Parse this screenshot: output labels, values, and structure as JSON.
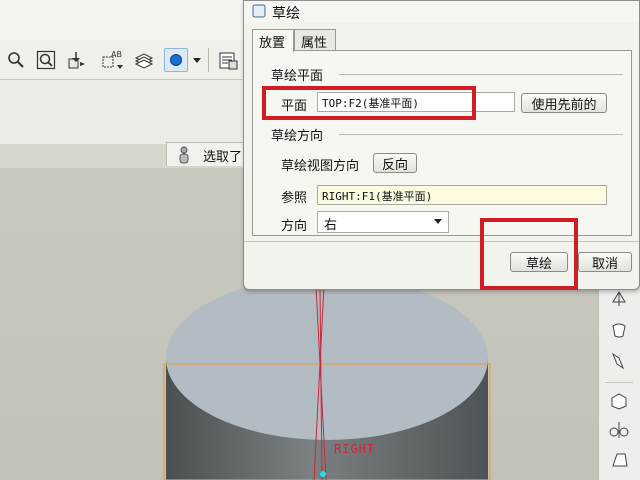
{
  "dialog": {
    "title": "草绘",
    "tabs": [
      {
        "label": "放置",
        "selected": true
      },
      {
        "label": "属性",
        "selected": false
      }
    ],
    "sketch_plane": {
      "group_title": "草绘平面",
      "plane_label": "平面",
      "plane_value": "TOP:F2(基准平面)",
      "use_previous_label": "使用先前的"
    },
    "sketch_orientation": {
      "group_title": "草绘方向",
      "view_direction_label": "草绘视图方向",
      "flip_label": "反向",
      "reference_label": "参照",
      "reference_value": "RIGHT:F1(基准平面)",
      "orientation_label": "方向",
      "orientation_value": "右"
    },
    "sketch_button_label": "草绘",
    "cancel_button_label": "取消"
  },
  "status": {
    "text": "选取了"
  },
  "viewport": {
    "datum_label": "RIGHT"
  },
  "colors": {
    "highlight": "#d01c24",
    "dialog_bg": "#f3f3ee",
    "model_gray": "#5e6365",
    "datum_red": "#c8283c"
  },
  "icons": [
    "zoom-icon",
    "zoom-window-icon",
    "repaint-icon",
    "plane-display-icon",
    "layers-icon",
    "shading-icon",
    "view-manager-icon",
    "user-icon"
  ]
}
